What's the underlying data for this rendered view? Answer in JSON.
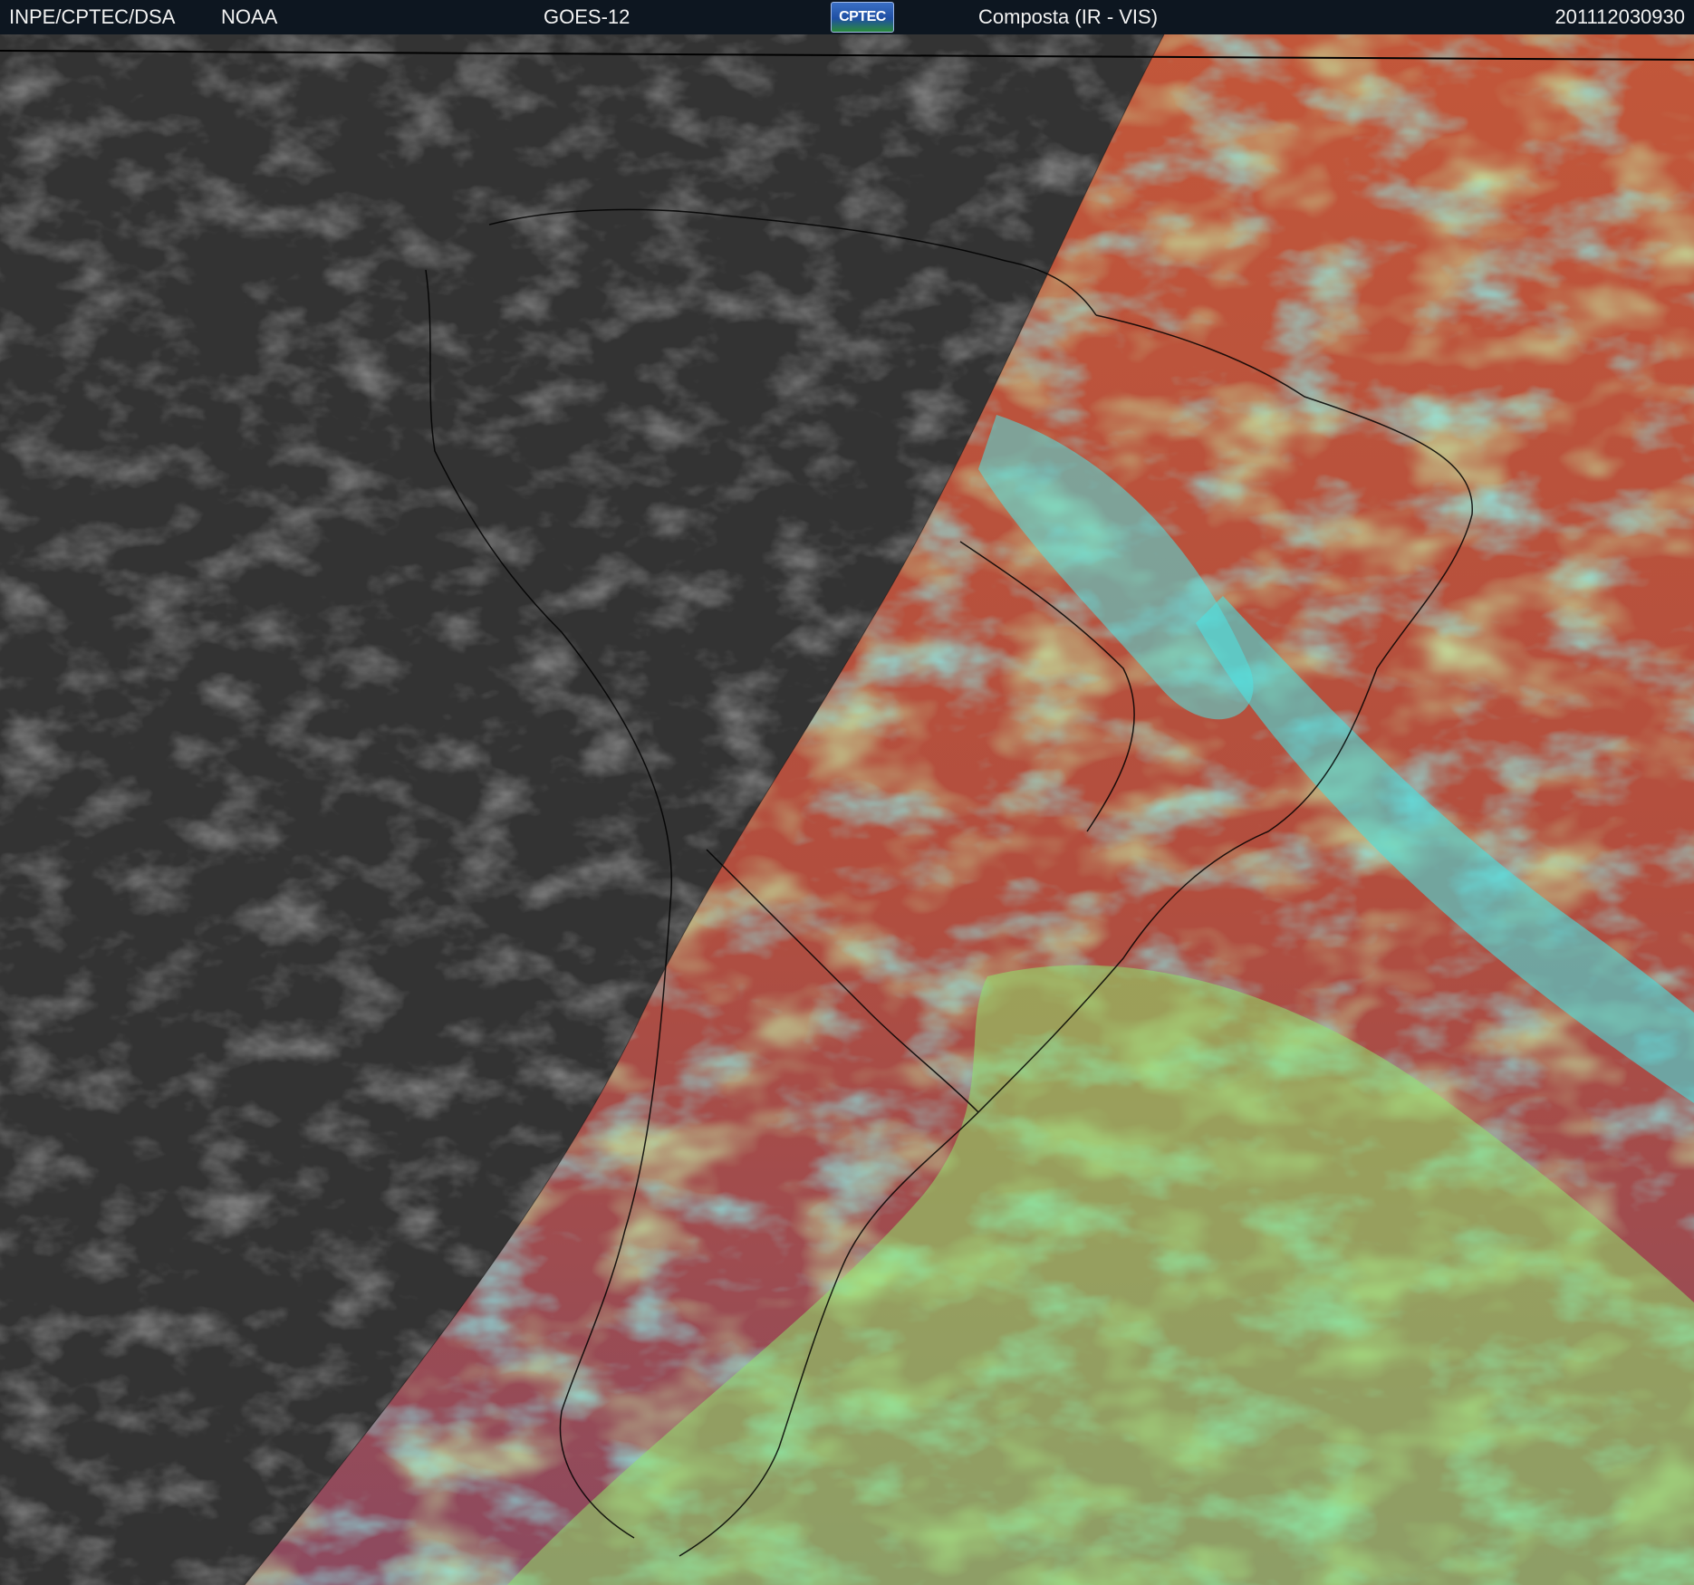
{
  "header": {
    "agency": "INPE/CPTEC/DSA",
    "source": "NOAA",
    "satellite": "GOES-12",
    "logo_text": "CPTEC",
    "product": "Composta (IR - VIS)",
    "timestamp": "201112030930"
  },
  "colors": {
    "header_background": "#0d1620",
    "night_side_gray": "#3a3a3a",
    "day_side_ocean_red": "#b8513a",
    "day_side_cloud_cyan": "#3fe6e6",
    "day_side_cloud_green": "#8de86a",
    "day_side_land_magenta": "#8a4a62",
    "coastline": "#000000"
  }
}
